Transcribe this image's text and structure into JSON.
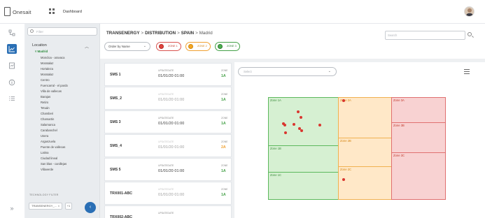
{
  "header": {
    "logo_text": "Onesait",
    "nav_label": "Dashboard"
  },
  "rail": {
    "icons": [
      "hierarchy-icon",
      "chart-line-icon",
      "report-icon",
      "info-icon",
      "list-icon",
      "expand-icon"
    ],
    "active_index": 1,
    "expand_glyph": "»"
  },
  "filter": {
    "search_placeholder": "Filter",
    "location_title": "Location",
    "root_label": "Madrid",
    "locations": [
      "Moncloa - aravaca",
      "Moratalaz",
      "Hortaleza",
      "Moratalaz",
      "Centro",
      "Fuencarral - el pardo",
      "Villa de vallecas",
      "Barajas",
      "Retiro",
      "Tetuán",
      "Chamberi",
      "Chamartin",
      "Salamanca",
      "Carabanchel",
      "Usera",
      "Arganzuela",
      "Puente de vallecas",
      "Latina",
      "Ciudad lineal",
      "San blas - canillejas",
      "Villaverde"
    ],
    "tech_title": "TECHNOLOGY FILTER",
    "tech_chip": "TRANSENERGY_…",
    "tech_more": "+1",
    "go_glyph": "‹"
  },
  "main": {
    "breadcrumb": [
      "TRANSENERGY",
      "DISTRIBUTION",
      "SPAIN",
      "Madrid"
    ],
    "breadcrumb_sep": ">",
    "order_label": "Order by Name",
    "zones": [
      {
        "label": "ZONE 1",
        "color": "#e0443e"
      },
      {
        "label": "ZONE 2",
        "color": "#f5a623"
      },
      {
        "label": "ZONE 3",
        "color": "#4caf50"
      }
    ],
    "search_placeholder": "Search"
  },
  "cards": {
    "update_label": "UPDATEDATE",
    "zone_label": "ZONE",
    "items": [
      {
        "name": "SMS 1",
        "date": "01/01/20 01:00",
        "zone": "1A",
        "zone_color": "#43a047",
        "faded": false
      },
      {
        "name": "SMS_2",
        "date": "01/01/20 01:00",
        "zone": "1A",
        "zone_color": "#43a047",
        "faded": true
      },
      {
        "name": "SMS 3",
        "date": "01/01/20 01:00",
        "zone": "1A",
        "zone_color": "#43a047",
        "faded": false
      },
      {
        "name": "SMS_4",
        "date": "01/01/20 01:00",
        "zone": "2A",
        "zone_color": "#f0a030",
        "faded": true
      },
      {
        "name": "SMS 5",
        "date": "01/01/20 01:00",
        "zone": "1A",
        "zone_color": "#43a047",
        "faded": false
      },
      {
        "name": "TRX001-ABC",
        "date": "01/01/20 01:00",
        "zone": "1A",
        "zone_color": "#43a047",
        "faded": true
      },
      {
        "name": "TRX002-ABC",
        "date": "",
        "zone": "",
        "zone_color": "#43a047",
        "faded": false
      }
    ]
  },
  "treemap_panel": {
    "select_placeholder": "Select",
    "zones": {
      "g1": "Zone 1A",
      "g2": "Zone 1B",
      "g3": "Zone 1C",
      "o1": "Zone 2A",
      "o2": "Zone 2B",
      "o3": "Zone 2C",
      "r1": "Zone 3A",
      "r2": "Zone 3B",
      "r3": "Zone 3C"
    }
  }
}
